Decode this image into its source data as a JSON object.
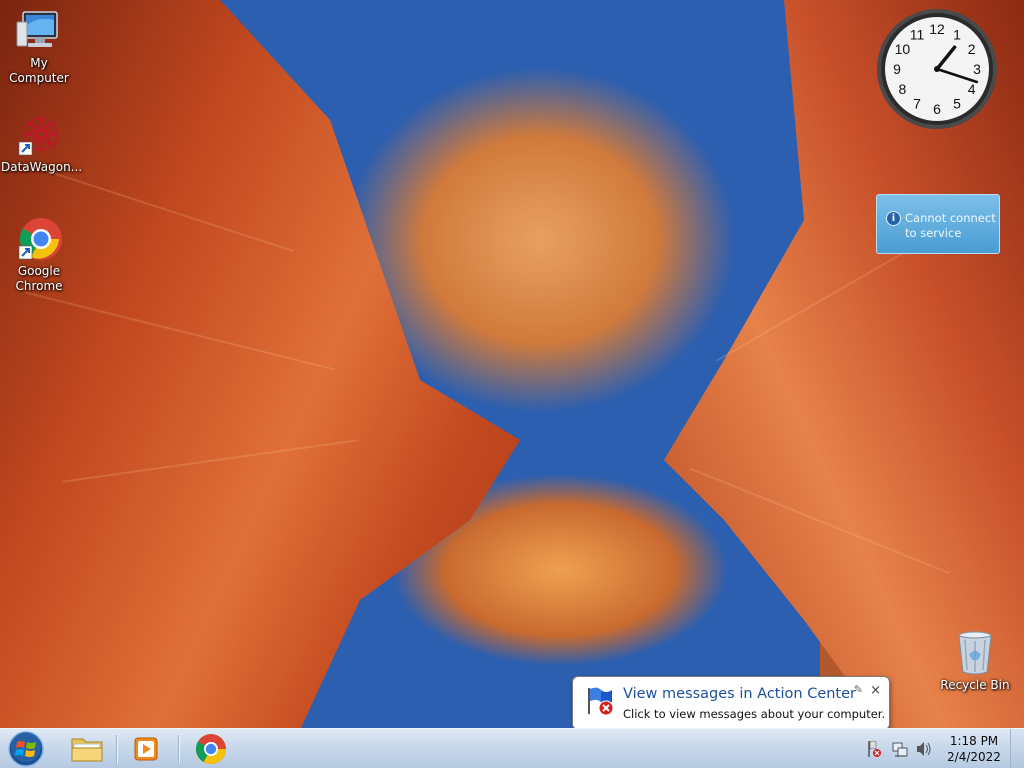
{
  "desktop": {
    "icons": [
      {
        "label_line1": "My Computer",
        "label_line2": "",
        "icon": "computer-icon"
      },
      {
        "label_line1": "DataWagon...",
        "label_line2": "",
        "icon": "datawagon-icon"
      },
      {
        "label_line1": "Google",
        "label_line2": "Chrome",
        "icon": "chrome-icon"
      },
      {
        "label_line1": "Recycle Bin",
        "label_line2": "",
        "icon": "recycle-bin-icon"
      }
    ]
  },
  "gadgets": {
    "clock": {
      "hours": [
        "12",
        "1",
        "2",
        "3",
        "4",
        "5",
        "6",
        "7",
        "8",
        "9",
        "10",
        "11"
      ],
      "hour": 1,
      "minute": 18
    },
    "notice": {
      "line1": "Cannot connect",
      "line2": "to service",
      "icon": "info-icon"
    }
  },
  "balloon": {
    "title": "View messages in Action Center",
    "subtitle": "Click to view messages about your computer.",
    "icon": "action-center-flag-icon",
    "close_label": "×"
  },
  "taskbar": {
    "pinned": [
      {
        "name": "windows-explorer",
        "icon": "folder-icon"
      },
      {
        "name": "media-player",
        "icon": "media-player-icon"
      },
      {
        "name": "google-chrome",
        "icon": "chrome-icon"
      }
    ],
    "time": "1:18 PM",
    "date": "2/4/2022"
  },
  "colors": {
    "taskbar": "#c6d7ea",
    "balloon_title": "#1e50a0",
    "notice_bg": "#4a9cd4"
  }
}
